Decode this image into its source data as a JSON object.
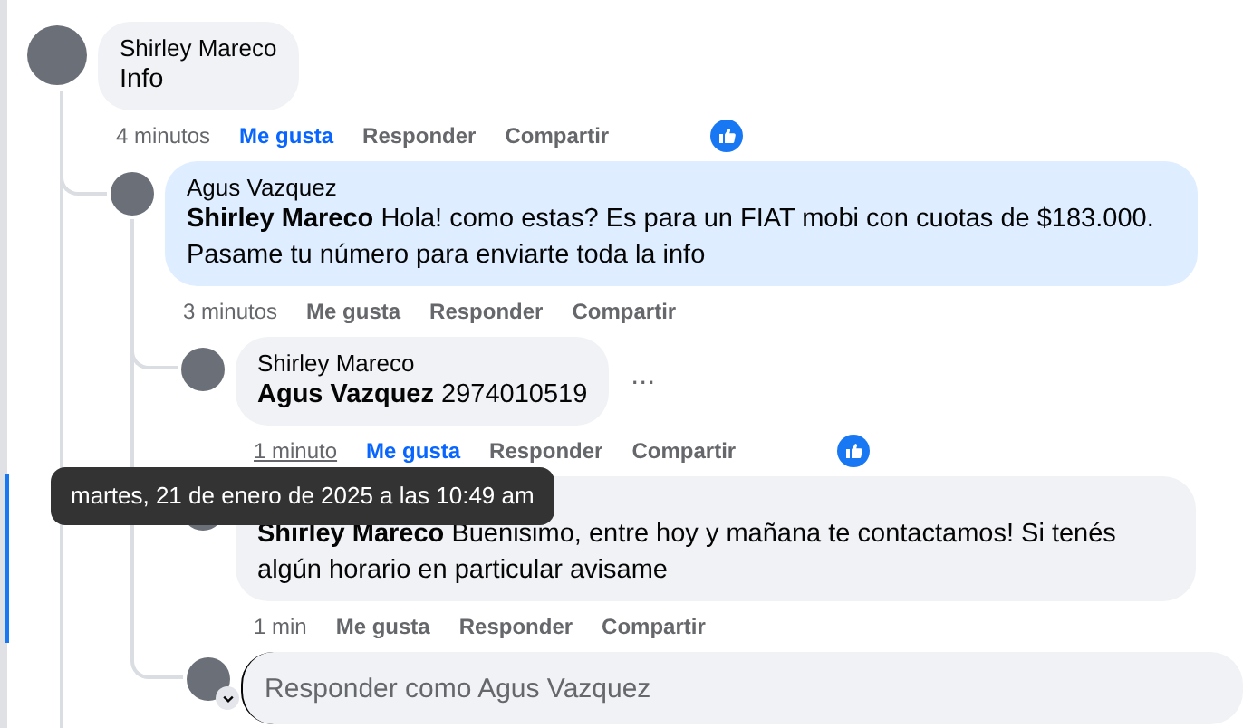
{
  "comments": [
    {
      "author": "Shirley Mareco",
      "text": "Info",
      "highlighted": false,
      "time": "4 minutos",
      "time_hovered": false,
      "like": "Me gusta",
      "liked": true,
      "reply": "Responder",
      "share": "Compartir",
      "reaction": true,
      "children": [
        {
          "author": "Agus Vazquez",
          "text": "**Shirley Mareco** Hola! como estas? Es para un FIAT mobi con cuotas de $183.000. Pasame tu número para enviarte toda la info",
          "highlighted": true,
          "time": "3 minutos",
          "time_hovered": false,
          "like": "Me gusta",
          "liked": false,
          "reply": "Responder",
          "share": "Compartir",
          "reaction": false,
          "reply_box": {
            "placeholder": "Responder como Agus Vazquez"
          },
          "children": [
            {
              "author": "Shirley Mareco",
              "text": "**Agus Vazquez** 2974010519",
              "highlighted": false,
              "menu": "...",
              "time": "1 minuto",
              "time_hovered": true,
              "like": "Me gusta",
              "liked": true,
              "reply": "Responder",
              "share": "Compartir",
              "reaction": true
            },
            {
              "text": "**Shirley Mareco** Buenisimo, entre hoy y mañana te contactamos! Si tenés algún horario en particular avisame",
              "highlighted": false,
              "time": "1 min",
              "time_hovered": false,
              "like": "Me gusta",
              "liked": false,
              "reply": "Responder",
              "share": "Compartir",
              "reaction": false
            }
          ]
        }
      ]
    }
  ],
  "tooltip": {
    "text": "martes, 21 de enero de 2025 a las 10:49 am"
  }
}
